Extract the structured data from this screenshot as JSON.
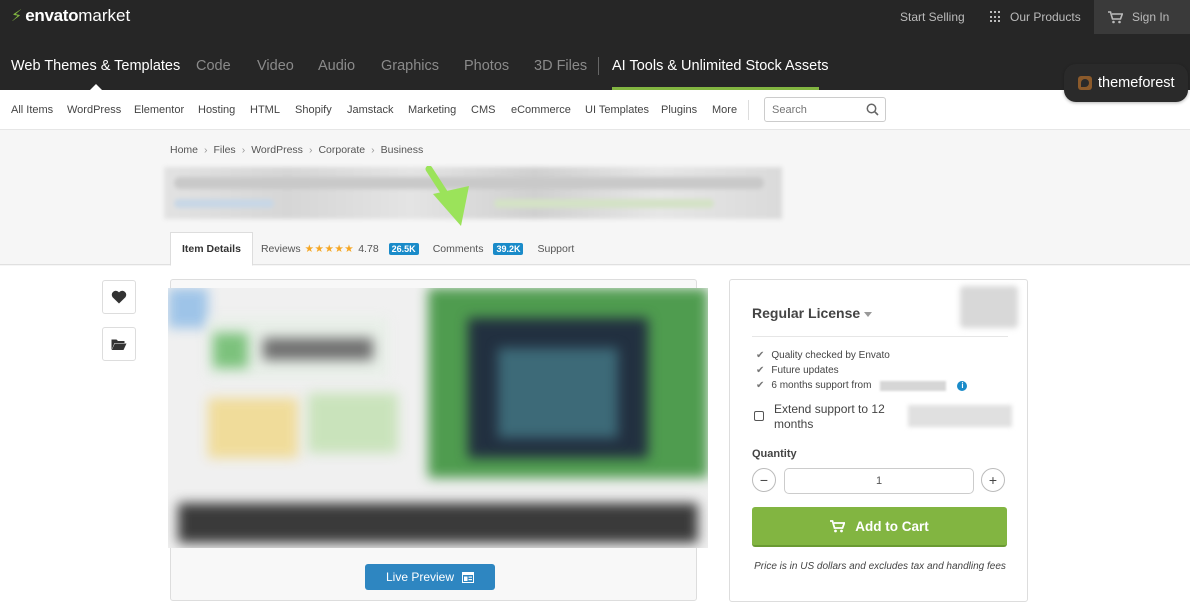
{
  "brand": {
    "envato": "envato",
    "market": "market",
    "themeforest": "themeforest"
  },
  "topbar": {
    "start_selling": "Start Selling",
    "our_products": "Our Products",
    "sign_in": "Sign In"
  },
  "categories": [
    "Web Themes & Templates",
    "Code",
    "Video",
    "Audio",
    "Graphics",
    "Photos",
    "3D Files",
    "AI Tools & Unlimited Stock Assets"
  ],
  "subnav": {
    "items": [
      "All Items",
      "WordPress",
      "Elementor",
      "Hosting",
      "HTML",
      "Shopify",
      "Jamstack",
      "Marketing",
      "CMS",
      "eCommerce",
      "UI Templates",
      "Plugins",
      "More"
    ],
    "search_placeholder": "Search"
  },
  "breadcrumb": [
    "Home",
    "Files",
    "WordPress",
    "Corporate",
    "Business"
  ],
  "tabs": {
    "item_details": "Item Details",
    "reviews": "Reviews",
    "rating": "4.78",
    "rating_stars": 5,
    "reviews_count": "26.5K",
    "comments": "Comments",
    "comments_count": "39.2K",
    "support": "Support"
  },
  "preview": {
    "live_preview": "Live Preview"
  },
  "purchase": {
    "license": "Regular License",
    "features": [
      "Quality checked by Envato",
      "Future updates",
      "6 months support from"
    ],
    "extend_support": "Extend support to 12 months",
    "quantity_label": "Quantity",
    "quantity": "1",
    "add_to_cart": "Add to Cart",
    "price_note": "Price is in US dollars and excludes tax and handling fees"
  },
  "colors": {
    "accent_green": "#82b541",
    "topbar_bg": "#262626",
    "badge_blue": "#1a8bc9",
    "preview_blue": "#2e86c1",
    "annotation_arrow": "#9be35a"
  }
}
